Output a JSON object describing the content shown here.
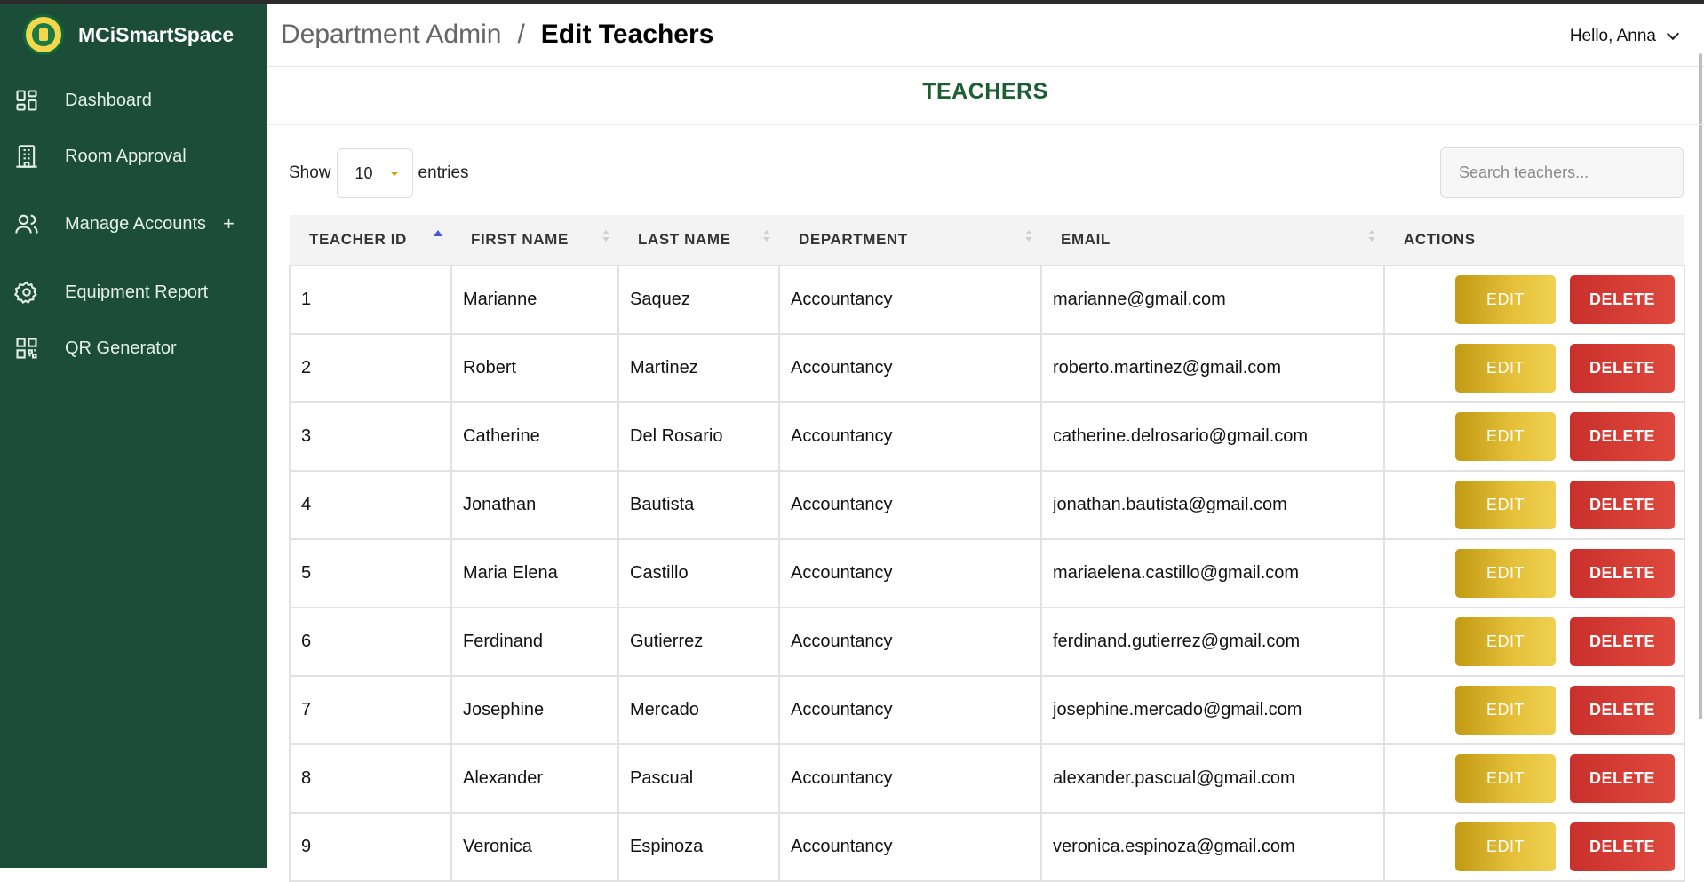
{
  "app": {
    "brand_name": "MCiSmartSpace"
  },
  "sidebar": {
    "items": [
      {
        "label": "Dashboard",
        "icon": "dashboard-icon"
      },
      {
        "label": "Room Approval",
        "icon": "building-icon"
      },
      {
        "label": "Manage Accounts",
        "icon": "users-icon",
        "expand": "+"
      },
      {
        "label": "Equipment Report",
        "icon": "gear-icon"
      },
      {
        "label": "QR Generator",
        "icon": "qr-code-icon"
      }
    ]
  },
  "header": {
    "breadcrumb_parent": "Department Admin",
    "breadcrumb_sep": "/",
    "breadcrumb_current": "Edit Teachers",
    "user_greeting": "Hello, Anna"
  },
  "section": {
    "title": "TEACHERS"
  },
  "controls": {
    "show_label": "Show",
    "entries_value": "10",
    "entries_label": "entries",
    "search_placeholder": "Search teachers..."
  },
  "table": {
    "columns": [
      "TEACHER ID",
      "FIRST NAME",
      "LAST NAME",
      "DEPARTMENT",
      "EMAIL",
      "ACTIONS"
    ],
    "edit_label": "EDIT",
    "delete_label": "DELETE",
    "rows": [
      {
        "id": "1",
        "first": "Marianne",
        "last": "Saquez",
        "dept": "Accountancy",
        "email": "marianne@gmail.com"
      },
      {
        "id": "2",
        "first": "Robert",
        "last": "Martinez",
        "dept": "Accountancy",
        "email": "roberto.martinez@gmail.com"
      },
      {
        "id": "3",
        "first": "Catherine",
        "last": "Del Rosario",
        "dept": "Accountancy",
        "email": "catherine.delrosario@gmail.com"
      },
      {
        "id": "4",
        "first": "Jonathan",
        "last": "Bautista",
        "dept": "Accountancy",
        "email": "jonathan.bautista@gmail.com"
      },
      {
        "id": "5",
        "first": "Maria Elena",
        "last": "Castillo",
        "dept": "Accountancy",
        "email": "mariaelena.castillo@gmail.com"
      },
      {
        "id": "6",
        "first": "Ferdinand",
        "last": "Gutierrez",
        "dept": "Accountancy",
        "email": "ferdinand.gutierrez@gmail.com"
      },
      {
        "id": "7",
        "first": "Josephine",
        "last": "Mercado",
        "dept": "Accountancy",
        "email": "josephine.mercado@gmail.com"
      },
      {
        "id": "8",
        "first": "Alexander",
        "last": "Pascual",
        "dept": "Accountancy",
        "email": "alexander.pascual@gmail.com"
      },
      {
        "id": "9",
        "first": "Veronica",
        "last": "Espinoza",
        "dept": "Accountancy",
        "email": "veronica.espinoza@gmail.com"
      }
    ]
  },
  "colors": {
    "sidebar_bg": "#1c4d38",
    "title_green": "#1b5e33",
    "edit_gold": "#d4ae2a",
    "delete_red": "#d63b32"
  }
}
